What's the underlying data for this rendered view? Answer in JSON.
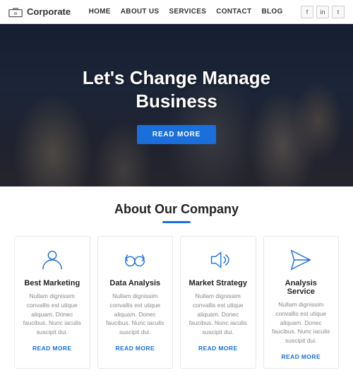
{
  "header": {
    "logo_text": "Corporate",
    "nav_items": [
      "HOME",
      "ABOUT US",
      "SERVICES",
      "CONTACT",
      "BLOG"
    ],
    "social": [
      "f",
      "in",
      "t"
    ]
  },
  "hero": {
    "title_line1": "Let's Change Manage",
    "title_line2": "Business",
    "cta_label": "READ MORE"
  },
  "about": {
    "section_title": "About Our Company",
    "cards": [
      {
        "icon": "person",
        "title": "Best Marketing",
        "text": "Nullam dignissim convallis est utique aliquam. Donec faucibus. Nunc iaculis suscipit dui.",
        "link": "READ MORE"
      },
      {
        "icon": "glasses",
        "title": "Data Analysis",
        "text": "Nullam dignissim convallis est utique aliquam. Donec faucibus. Nunc iaculis suscipit dui.",
        "link": "READ MORE"
      },
      {
        "icon": "speaker",
        "title": "Market Strategy",
        "text": "Nullam dignissim convallis est utique aliquam. Donec faucibus. Nunc iaculis suscipit dui.",
        "link": "READ MORE"
      },
      {
        "icon": "send",
        "title": "Analysis Service",
        "text": "Nullam dignissim convallis est utique aliquam. Donec faucibus. Nunc iaculis suscipit dui.",
        "link": "READ MORE"
      }
    ]
  }
}
